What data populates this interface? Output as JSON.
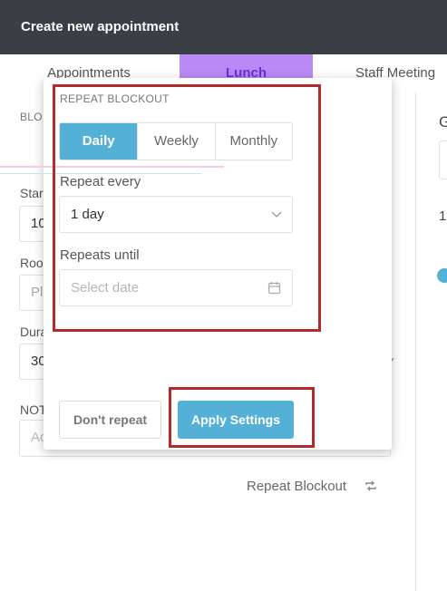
{
  "header": {
    "title": "Create new appointment"
  },
  "tabs": [
    {
      "label": "Appointments"
    },
    {
      "label": "Lunch"
    },
    {
      "label": "Staff Meeting"
    }
  ],
  "background": {
    "section_label": "BLO",
    "start_label": "Star",
    "start_value": "10",
    "room_label": "Roo",
    "room_placeholder": "Pl",
    "duration_label": "Dura",
    "duration_value": "30",
    "notes_label": "NOT",
    "notes_placeholder": "Ac",
    "right_g": "G",
    "right_1": "1",
    "repeat_link": "Repeat Blockout"
  },
  "popup": {
    "title": "REPEAT BLOCKOUT",
    "frequency_options": [
      "Daily",
      "Weekly",
      "Monthly"
    ],
    "frequency_selected": "Daily",
    "repeat_every_label": "Repeat every",
    "repeat_every_value": "1 day",
    "repeats_until_label": "Repeats until",
    "repeats_until_placeholder": "Select date",
    "dont_repeat_label": "Don't repeat",
    "apply_label": "Apply Settings"
  },
  "colors": {
    "header_bg": "#3b3e45",
    "accent": "#55b0d7",
    "tab_active_bg": "#b98af5",
    "highlight_outline": "#b22a2a"
  },
  "icons": [
    "chevron-down-icon",
    "calendar-icon",
    "repeat-icon",
    "info-dot-icon"
  ]
}
